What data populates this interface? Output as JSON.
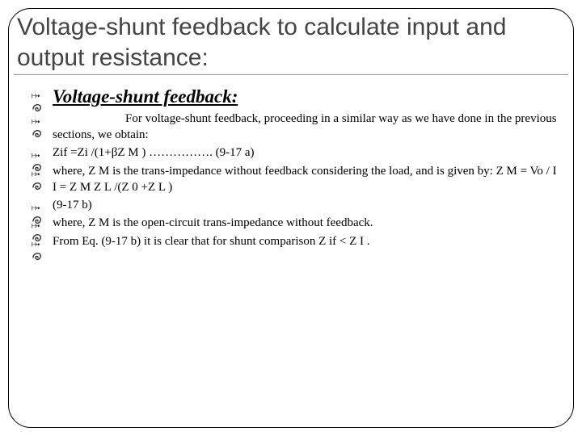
{
  "title": "Voltage-shunt feedback to calculate input and output resistance:",
  "subheading": "Voltage-shunt feedback:",
  "items": {
    "intro": "For voltage-shunt feedback, proceeding in a similar way as we have done in the previous sections, we obtain:",
    "eq1": "Zif =Zi /(1+βZ M ) ……………. (9-17 a)",
    "where1": "where, Z M is the trans-impedance without feedback considering the load, and is given by: Z M  = Vo / I I  = Z M Z L /(Z 0 +Z L )",
    "eqref": "(9-17 b)",
    "where2": "where, Z M is the open-circuit trans-impedance without feedback.",
    "conclusion": "From Eq. (9-17 b) it is clear that for shunt comparison Z if < Z I  ."
  }
}
